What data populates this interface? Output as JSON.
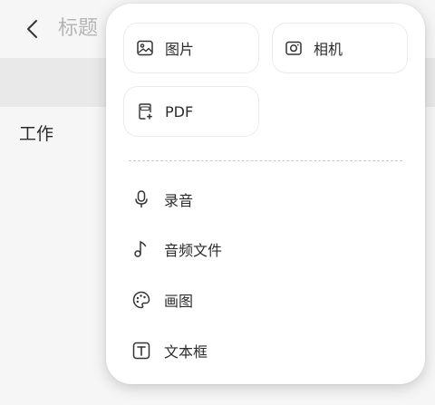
{
  "header": {
    "title": "标题"
  },
  "content": {
    "text": "工作"
  },
  "popup": {
    "tiles": [
      {
        "label": "图片",
        "icon": "image-icon"
      },
      {
        "label": "相机",
        "icon": "camera-icon"
      },
      {
        "label": "PDF",
        "icon": "pdf-icon"
      }
    ],
    "items": [
      {
        "label": "录音",
        "icon": "microphone-icon"
      },
      {
        "label": "音频文件",
        "icon": "music-note-icon"
      },
      {
        "label": "画图",
        "icon": "palette-icon"
      },
      {
        "label": "文本框",
        "icon": "text-box-icon"
      }
    ]
  },
  "colors": {
    "background": "#f6f6f6",
    "popup": "#ffffff",
    "text": "#2c2c2c",
    "muted_title": "#b5b5b5"
  }
}
